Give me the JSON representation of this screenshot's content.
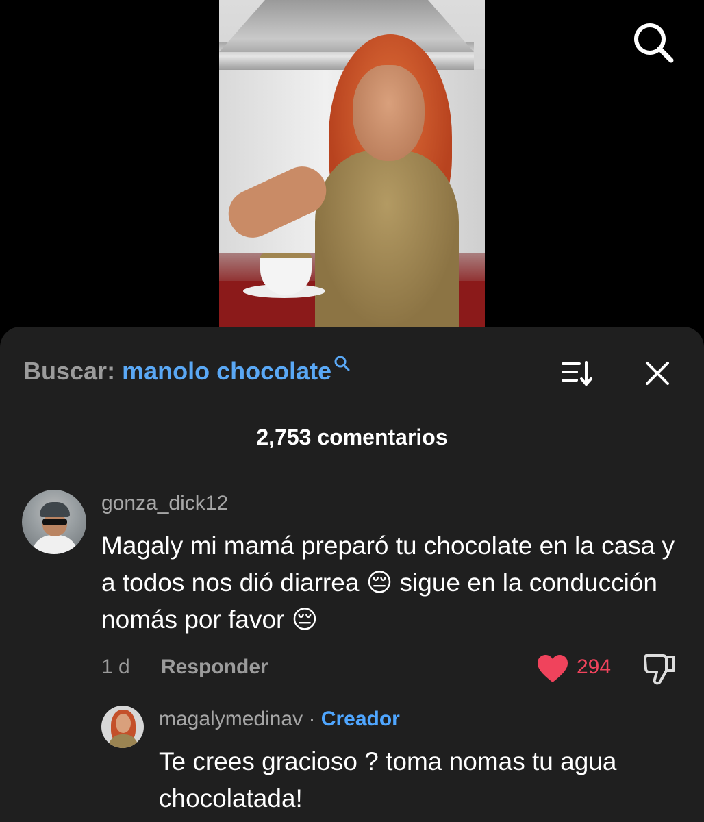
{
  "search": {
    "label": "Buscar:",
    "query": "manolo chocolate"
  },
  "comments_count": "2,753 comentarios",
  "comment": {
    "username": "gonza_dick12",
    "text": "Magaly mi mamá preparó tu chocolate en la casa y a todos nos dió diarrea 😔 sigue en la conducción nomás por favor 😔",
    "time": "1 d",
    "reply_label": "Responder",
    "likes": "294"
  },
  "reply": {
    "username": "magalymedinav",
    "separator": "·",
    "badge": "Creador",
    "text": "Te crees gracioso ? toma nomas tu agua chocolatada!"
  },
  "colors": {
    "link_blue": "#5aa8f5",
    "creator_blue": "#4fa6ff",
    "like_red": "#f0435c",
    "sheet_bg": "#1f1f1f"
  },
  "icons": [
    "search-icon",
    "sort-icon",
    "close-icon",
    "heart-icon",
    "dislike-icon"
  ]
}
